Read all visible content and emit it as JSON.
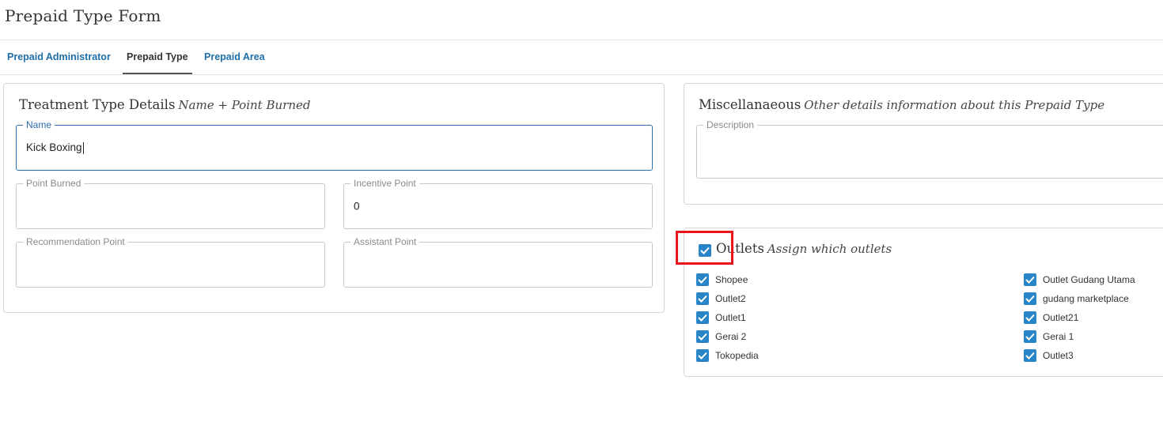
{
  "page": {
    "title": "Prepaid Type Form"
  },
  "tabs": [
    {
      "label": "Prepaid Administrator",
      "active": false
    },
    {
      "label": "Prepaid Type",
      "active": true
    },
    {
      "label": "Prepaid Area",
      "active": false
    }
  ],
  "treatment": {
    "title": "Treatment Type Details",
    "subtitle": "Name + Point Burned",
    "name": {
      "label": "Name",
      "value": "Kick Boxing"
    },
    "point_burned": {
      "label": "Point Burned",
      "value": ""
    },
    "incentive_point": {
      "label": "Incentive Point",
      "value": "0"
    },
    "recommendation_point": {
      "label": "Recommendation Point",
      "value": ""
    },
    "assistant_point": {
      "label": "Assistant Point",
      "value": ""
    }
  },
  "misc": {
    "title": "Miscellanaeous",
    "subtitle": "Other details information about this Prepaid Type",
    "description": {
      "label": "Description",
      "value": ""
    }
  },
  "outlets": {
    "title": "Outlets",
    "subtitle": "Assign which outlets",
    "all_checked": true,
    "left": [
      {
        "label": "Shopee",
        "checked": true
      },
      {
        "label": "Outlet2",
        "checked": true
      },
      {
        "label": "Outlet1",
        "checked": true
      },
      {
        "label": "Gerai 2",
        "checked": true
      },
      {
        "label": "Tokopedia",
        "checked": true
      }
    ],
    "right": [
      {
        "label": "Outlet Gudang Utama",
        "checked": true
      },
      {
        "label": "gudang marketplace",
        "checked": true
      },
      {
        "label": "Outlet21",
        "checked": true
      },
      {
        "label": "Gerai 1",
        "checked": true
      },
      {
        "label": "Outlet3",
        "checked": true
      }
    ]
  },
  "colors": {
    "accent": "#2a85c8",
    "link": "#1f6fa8",
    "highlight": "#e8141c",
    "focus": "#2a6fb0"
  },
  "icons": {
    "checkbox": "check-icon"
  }
}
